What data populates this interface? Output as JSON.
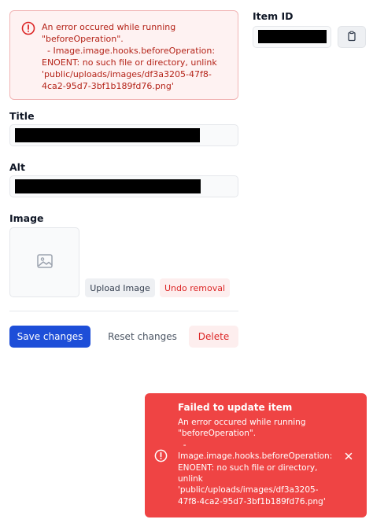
{
  "error_box": {
    "message": "An error occured while running \"beforeOperation\".\n  - Image.image.hooks.beforeOperation: ENOENT: no such file or directory, unlink 'public/uploads/images/df3a3205-47f8-4ca2-95d7-3bf1b189fd76.png'"
  },
  "item_id": {
    "label": "Item ID"
  },
  "form": {
    "title_label": "Title",
    "alt_label": "Alt",
    "image_label": "Image",
    "upload_label": "Upload Image",
    "undo_label": "Undo removal"
  },
  "actions": {
    "save_label": "Save changes",
    "reset_label": "Reset changes",
    "delete_label": "Delete"
  },
  "toast": {
    "title": "Failed to update item",
    "message": "An error occured while running \"beforeOperation\".\n  -\nImage.image.hooks.beforeOperation: ENOENT: no such file or directory, unlink\n'public/uploads/images/df3a3205-47f8-4ca2-95d7-3bf1b189fd76.png'"
  },
  "icons": {
    "error": "alert-circle-icon",
    "copy": "clipboard-icon",
    "image_placeholder": "image-icon",
    "close": "close-icon"
  },
  "colors": {
    "primary": "#1d4ed8",
    "danger": "#ef4444",
    "danger_text": "#dc2626",
    "error_bg": "#fef2f2"
  }
}
